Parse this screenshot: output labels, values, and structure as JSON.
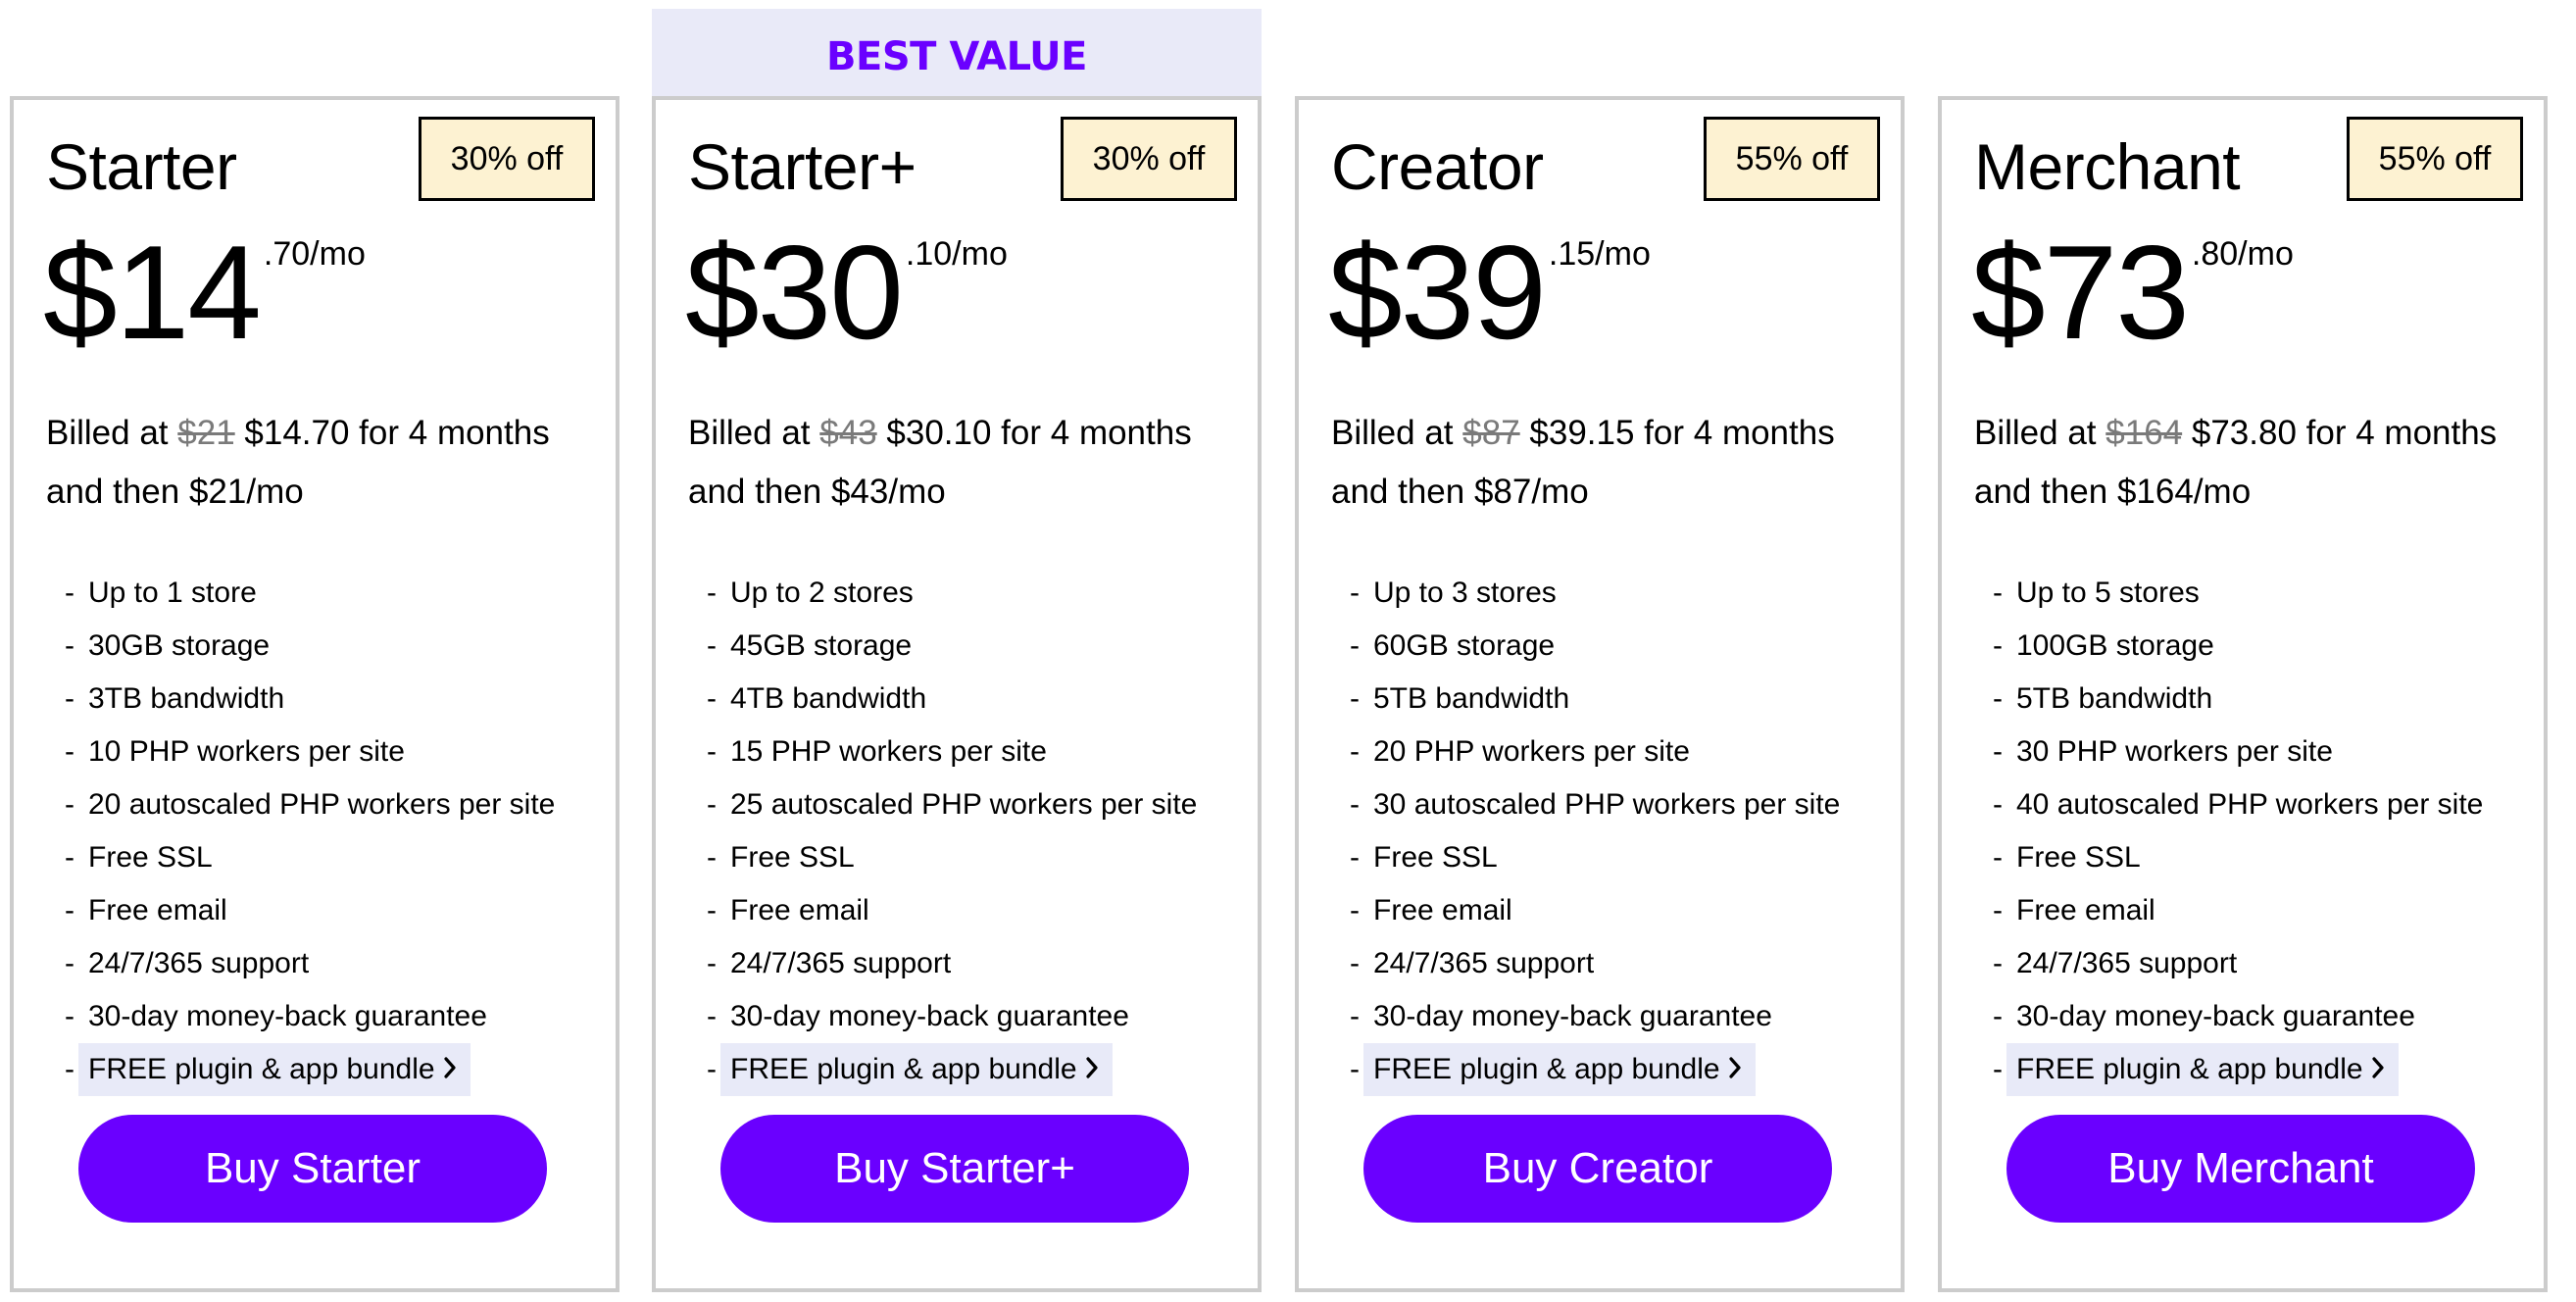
{
  "best_value_label": "BEST VALUE",
  "colors": {
    "accent": "#6a00ff",
    "badge_bg": "#fdf2d2",
    "highlight_bg": "#e8eaf8",
    "card_border": "#cccccc",
    "strike_text": "#7a7a7a"
  },
  "plans": [
    {
      "name": "Starter",
      "discount": "30% off",
      "price_whole": "$14",
      "price_cents": ".70/mo",
      "billing_prefix": "Billed at",
      "billing_original": "$21",
      "billing_discounted": "$14.70 for 4 months",
      "billing_then": "and then $21/mo",
      "features": [
        "Up to 1 store",
        "30GB storage",
        "3TB bandwidth",
        "10 PHP workers per site",
        "20 autoscaled PHP workers per site",
        "Free SSL",
        "Free email",
        "24/7/365 support",
        "30-day money-back guarantee"
      ],
      "bundle_link": "FREE plugin & app bundle",
      "button_label": "Buy Starter"
    },
    {
      "name": "Starter+",
      "discount": "30% off",
      "price_whole": "$30",
      "price_cents": ".10/mo",
      "billing_prefix": "Billed at",
      "billing_original": "$43",
      "billing_discounted": "$30.10 for 4 months",
      "billing_then": "and then $43/mo",
      "features": [
        "Up to 2 stores",
        "45GB storage",
        "4TB bandwidth",
        "15 PHP workers per site",
        "25 autoscaled PHP workers per site",
        "Free SSL",
        "Free email",
        "24/7/365 support",
        "30-day money-back guarantee"
      ],
      "bundle_link": "FREE plugin & app bundle",
      "button_label": "Buy Starter+"
    },
    {
      "name": "Creator",
      "discount": "55% off",
      "price_whole": "$39",
      "price_cents": ".15/mo",
      "billing_prefix": "Billed at",
      "billing_original": "$87",
      "billing_discounted": "$39.15 for 4 months",
      "billing_then": "and then $87/mo",
      "features": [
        "Up to 3 stores",
        "60GB storage",
        "5TB bandwidth",
        "20 PHP workers per site",
        "30 autoscaled PHP workers per site",
        "Free SSL",
        "Free email",
        "24/7/365 support",
        "30-day money-back guarantee"
      ],
      "bundle_link": "FREE plugin & app bundle",
      "button_label": "Buy Creator"
    },
    {
      "name": "Merchant",
      "discount": "55% off",
      "price_whole": "$73",
      "price_cents": ".80/mo",
      "billing_prefix": "Billed at",
      "billing_original": "$164",
      "billing_discounted": "$73.80 for 4 months",
      "billing_then": "and then $164/mo",
      "features": [
        "Up to 5 stores",
        "100GB storage",
        "5TB bandwidth",
        "30 PHP workers per site",
        "40 autoscaled PHP workers per site",
        "Free SSL",
        "Free email",
        "24/7/365 support",
        "30-day money-back guarantee"
      ],
      "bundle_link": "FREE plugin & app bundle",
      "button_label": "Buy Merchant"
    }
  ]
}
